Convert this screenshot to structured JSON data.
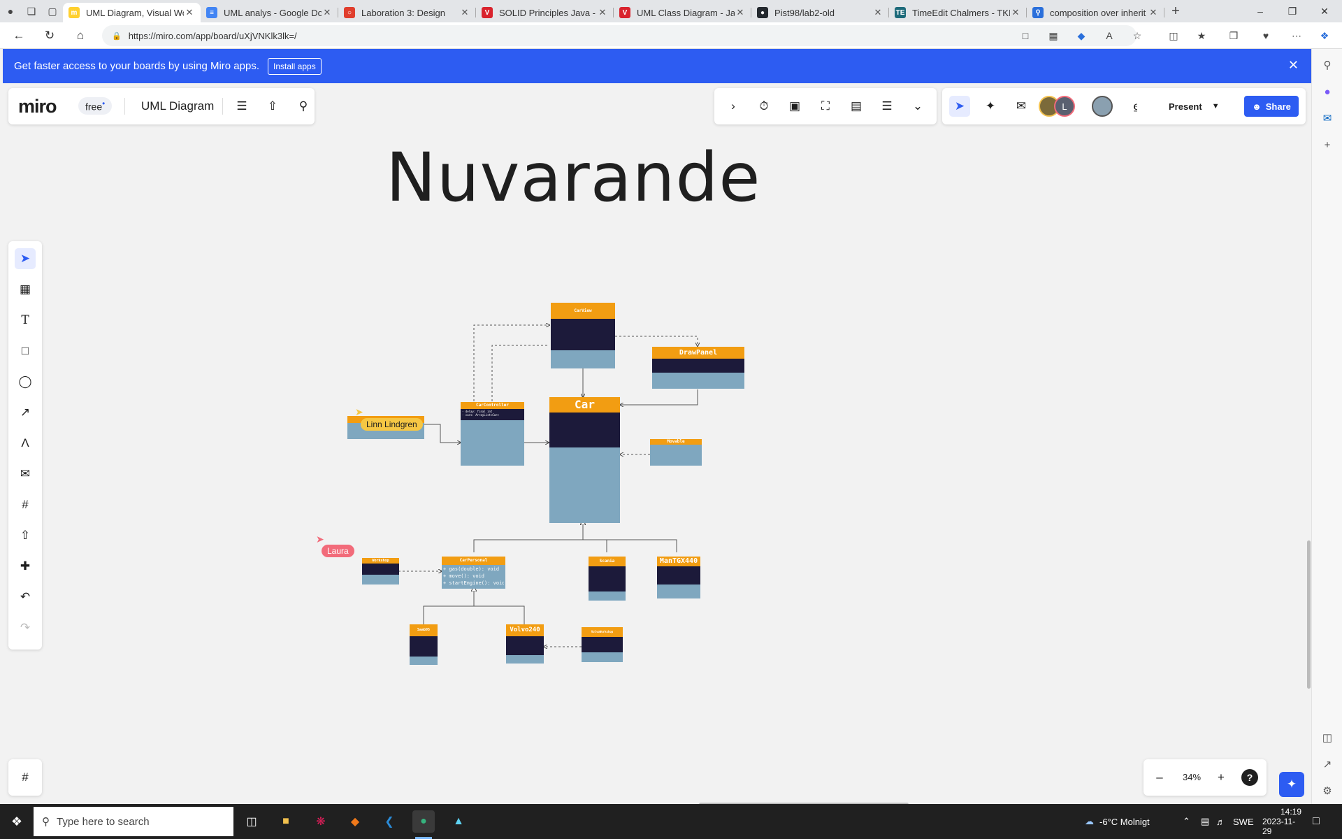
{
  "browser": {
    "tabs": [
      {
        "title": "UML Diagram, Visual Wo",
        "favicon": "miro",
        "color": "#ffd02f",
        "active": true
      },
      {
        "title": "UML analys - Google Do",
        "favicon": "docs",
        "color": "#4285f4"
      },
      {
        "title": "Laboration 3: Design",
        "favicon": "canvas",
        "color": "#e03e2d"
      },
      {
        "title": "SOLID Principles Java - Ja",
        "favicon": "v",
        "color": "#d9232d"
      },
      {
        "title": "UML Class Diagram - Jav",
        "favicon": "v",
        "color": "#d9232d"
      },
      {
        "title": "Pist98/lab2-old",
        "favicon": "github",
        "color": "#24292f"
      },
      {
        "title": "TimeEdit Chalmers - TKIT",
        "favicon": "TE",
        "color": "#1d6a7a"
      },
      {
        "title": "composition over inherit",
        "favicon": "search",
        "color": "#2a6fdb"
      }
    ],
    "url": "https://miro.com/app/board/uXjVNKlk3lk=/"
  },
  "banner": {
    "text": "Get faster access to your boards by using Miro apps.",
    "button": "Install apps"
  },
  "miro": {
    "logo": "miro",
    "plan_badge": "free",
    "board_title": "UML Diagram",
    "present_label": "Present",
    "share_label": "Share",
    "avatar_letter": "L",
    "zoom": "34%",
    "help": "?"
  },
  "canvas": {
    "heading": "Nuvarande",
    "cursors": [
      {
        "name": "Linn Lindgren",
        "color": "#f6c744"
      },
      {
        "name": "Laura",
        "color": "#f26b7a"
      }
    ],
    "uml": {
      "carview": {
        "name": "CarView"
      },
      "drawpanel": {
        "name": "DrawPanel"
      },
      "carcontroller": {
        "name": "CarController",
        "attributes": [
          "- delay: final int",
          "- cars: ArrayList<Car>"
        ]
      },
      "car": {
        "name": "Car"
      },
      "movable": {
        "name": "Movable"
      },
      "workshop": {
        "name": "Workshop"
      },
      "carpersonal": {
        "name": "CarPersonal",
        "methods": [
          "+ gas(double): void",
          "+ move(): void",
          "+ startEngine(): void"
        ]
      },
      "scania": {
        "name": "Scania"
      },
      "mantgx": {
        "name": "ManTGX440"
      },
      "saab": {
        "name": "Saab95"
      },
      "volvo": {
        "name": "Volvo240"
      },
      "volvoworkshop": {
        "name": "VolvoWorkshop"
      }
    }
  },
  "taskbar": {
    "search_placeholder": "Type here to search",
    "weather": "-6°C  Molnigt",
    "lang": "SWE",
    "time": "14:19",
    "date": "2023-11-29"
  }
}
